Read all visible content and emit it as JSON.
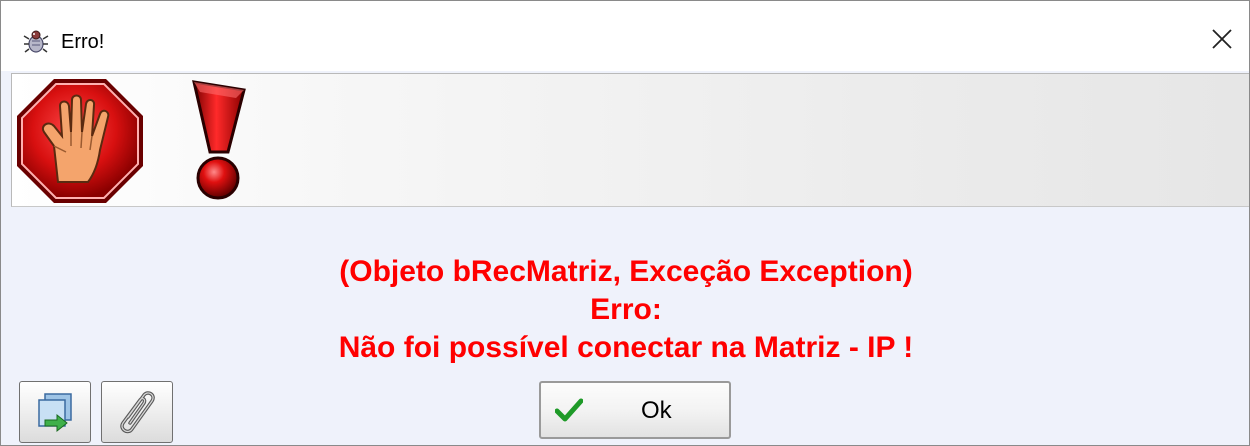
{
  "window": {
    "title": "Erro!",
    "icons": {
      "app": "app-bug-icon",
      "close": "close-icon"
    }
  },
  "banner": {
    "icons": [
      "stop-hand-icon",
      "exclamation-icon"
    ]
  },
  "message": {
    "lines": [
      "(Objeto bRecMatriz, Exceção Exception)",
      "Erro:",
      "Não foi possível conectar na Matriz - IP !"
    ],
    "color": "#ff0000"
  },
  "buttons": {
    "ok_label": "Ok",
    "tools": [
      "save-copy-icon",
      "paperclip-icon"
    ]
  }
}
